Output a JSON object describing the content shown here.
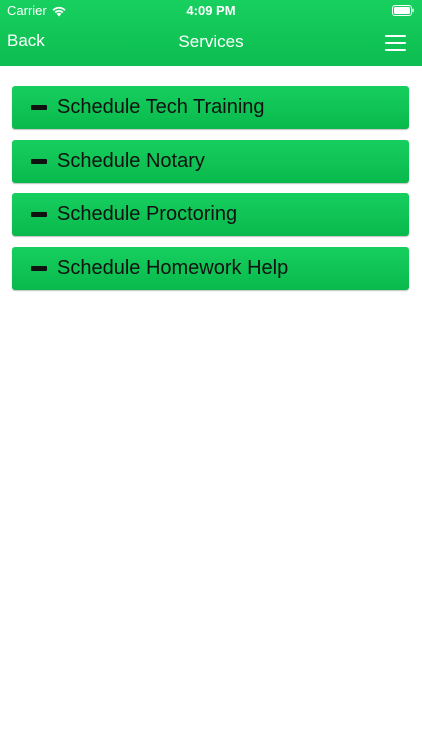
{
  "status_bar": {
    "carrier": "Carrier",
    "time": "4:09 PM",
    "wifi_icon": "wifi-icon",
    "battery_icon": "battery-icon"
  },
  "nav": {
    "back_label": "Back",
    "title": "Services",
    "menu_icon": "hamburger-menu-icon"
  },
  "colors": {
    "header_green": "#12c858",
    "button_green": "#0fc456",
    "text_dark": "#111111"
  },
  "services": [
    {
      "label": "Schedule Tech Training",
      "icon": "minus-icon"
    },
    {
      "label": "Schedule Notary",
      "icon": "minus-icon"
    },
    {
      "label": "Schedule Proctoring",
      "icon": "minus-icon"
    },
    {
      "label": "Schedule Homework Help",
      "icon": "minus-icon"
    }
  ]
}
